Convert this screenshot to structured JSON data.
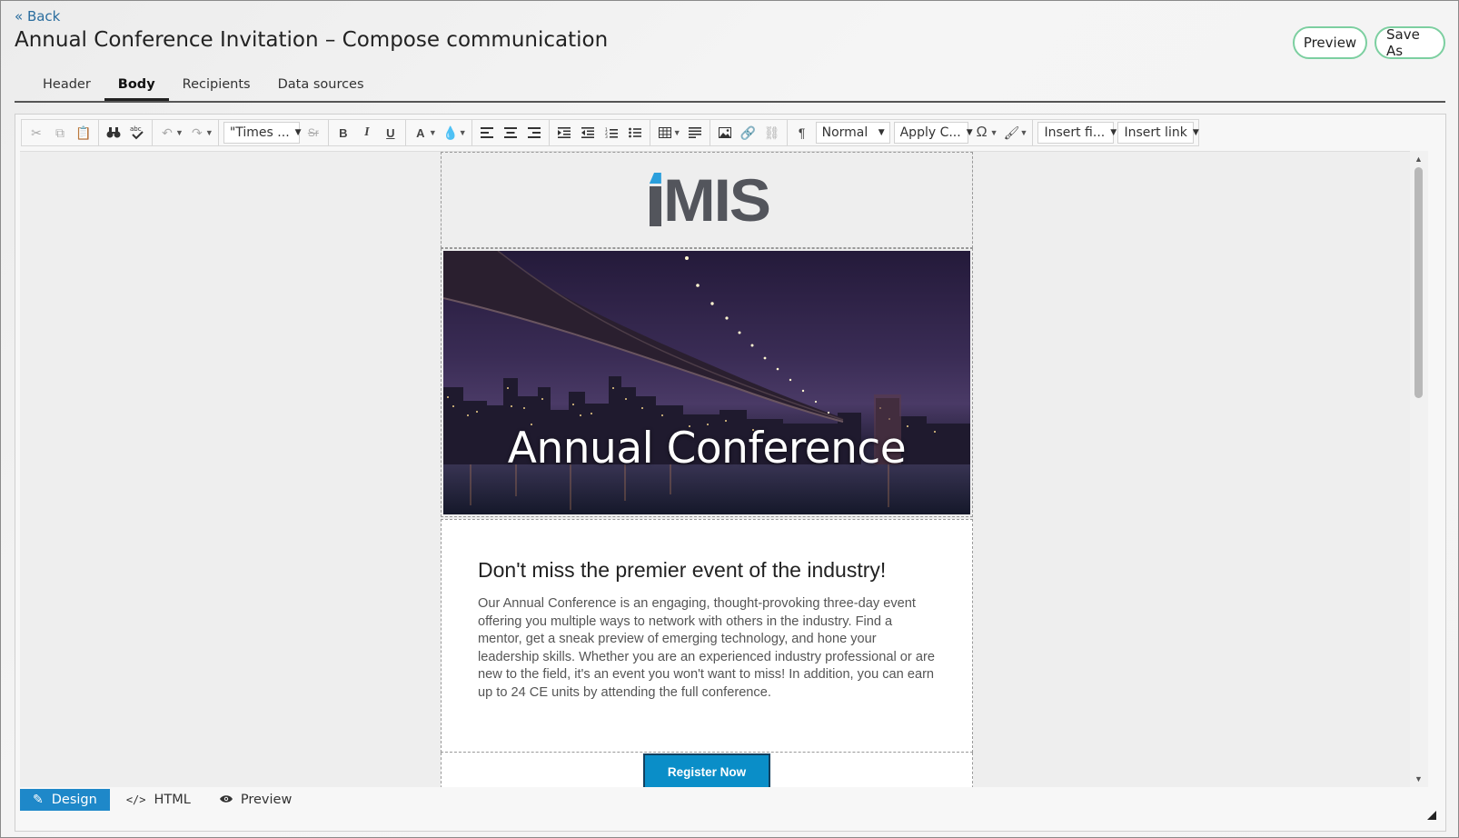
{
  "header": {
    "back_label": "« Back",
    "title": "Annual Conference Invitation – Compose communication",
    "preview_label": "Preview",
    "save_as_label": "Save As"
  },
  "tabs": [
    {
      "label": "Header",
      "active": false
    },
    {
      "label": "Body",
      "active": true
    },
    {
      "label": "Recipients",
      "active": false
    },
    {
      "label": "Data sources",
      "active": false
    }
  ],
  "toolbar": {
    "font_family": "\"Times ...",
    "paragraph_style": "Normal",
    "apply_css": "Apply C...",
    "insert_field": "Insert fi...",
    "insert_link": "Insert link"
  },
  "email": {
    "logo_text": "MIS",
    "logo_colors": {
      "text": "#53555c",
      "accent": "#2b9fdc"
    },
    "hero_title": "Annual Conference",
    "heading": "Don't miss the premier event of the industry!",
    "body": "Our Annual Conference is an engaging, thought-provoking three-day event offering you multiple ways to network with others in the industry. Find a mentor, get a sneak preview of emerging technology, and hone your leadership skills. Whether you are an experienced industry professional or are new to the field, it's an event you won't want to miss! In addition, you can earn up to 24 CE units by attending the full conference.",
    "cta_label": "Register Now",
    "cta_color": "#0a8ec8"
  },
  "modes": [
    {
      "label": "Design",
      "icon": "pencil-icon",
      "active": true
    },
    {
      "label": "HTML",
      "icon": "code-icon",
      "active": false
    },
    {
      "label": "Preview",
      "icon": "eye-icon",
      "active": false
    }
  ],
  "colors": {
    "accent_button_border": "#7ccfa0",
    "mode_active": "#1e88c9",
    "link": "#2a6d9e"
  }
}
